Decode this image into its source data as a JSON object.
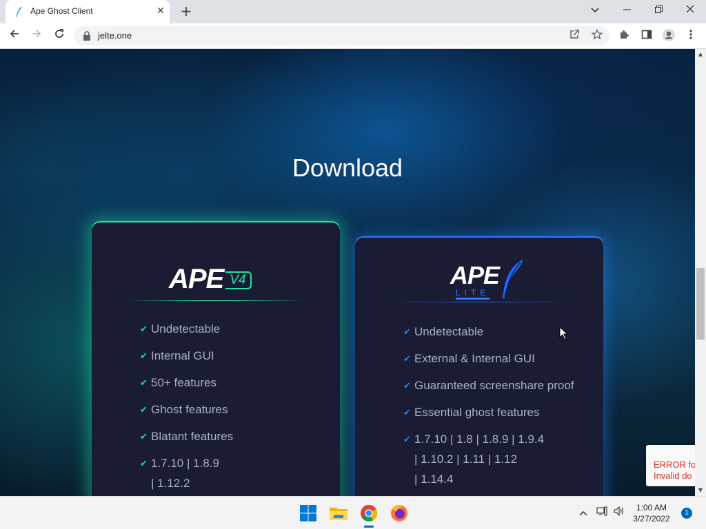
{
  "browser": {
    "tab_title": "Ape Ghost Client",
    "url": "jelte.one",
    "icons": {
      "back": "back-arrow-icon",
      "forward": "forward-arrow-icon",
      "reload": "reload-icon",
      "share": "share-icon",
      "bookmark": "star-icon",
      "extensions": "puzzle-icon",
      "side_panel": "side-panel-icon",
      "profile": "profile-icon",
      "menu": "kebab-menu-icon"
    }
  },
  "page": {
    "heading": "Download",
    "cards": [
      {
        "id": "v4",
        "logo_main": "APE",
        "logo_badge": "V4",
        "accent": "#22e5a3",
        "features": [
          "Undetectable",
          "Internal GUI",
          "50+ features",
          "Ghost features",
          "Blatant features",
          "1.7.10 | 1.8.9",
          "| 1.12.2"
        ]
      },
      {
        "id": "lite",
        "logo_main": "APE",
        "logo_badge": "LITE",
        "accent": "#2a7bff",
        "features": [
          "Undetectable",
          "External & Internal GUI",
          "Guaranteed screenshare proof",
          "Essential ghost features",
          "1.7.10 | 1.8 | 1.8.9 | 1.9.4",
          "| 1.10.2 | 1.11 | 1.12",
          "| 1.14.4"
        ]
      }
    ],
    "recaptcha_error": {
      "line1": "ERROR fo",
      "line2": "Invalid do"
    }
  },
  "taskbar": {
    "time": "1:00 AM",
    "date": "3/27/2022",
    "notifications": "1"
  }
}
